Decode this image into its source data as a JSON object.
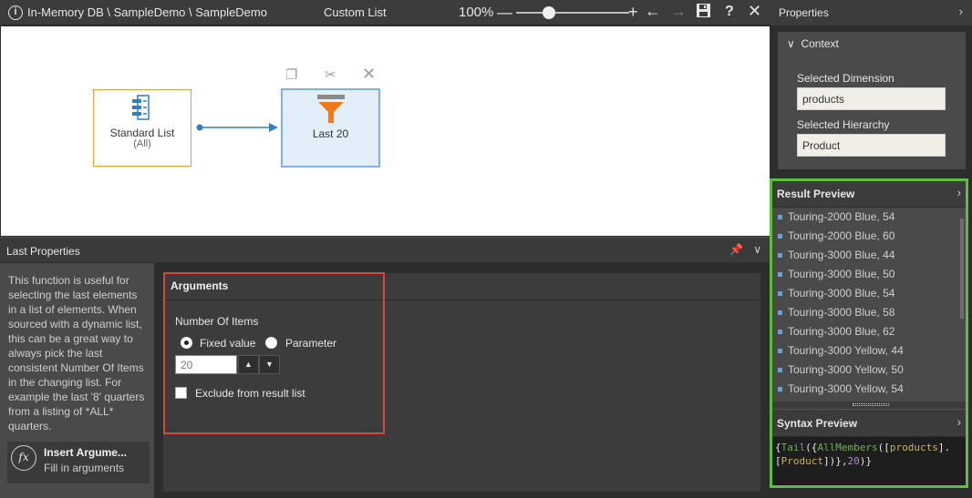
{
  "topbar": {
    "path": "In-Memory DB \\ SampleDemo \\ SampleDemo",
    "title": "Custom List",
    "zoom": "100%"
  },
  "canvas": {
    "node_standard": {
      "label": "Standard List",
      "sub": "(All)"
    },
    "node_last": {
      "label": "Last 20"
    }
  },
  "props": {
    "title": "Last Properties",
    "help": "This function is useful for selecting the last elements in a list of elements. When sourced with a dynamic list, this can be a great way to always pick the last consistent Number Of Items in the changing list. For example the last '8' quarters from a listing of *ALL* quarters.",
    "insert_title": "Insert Argume...",
    "insert_sub": "Fill in arguments",
    "args_title": "Arguments",
    "noi_label": "Number Of Items",
    "radio_fixed": "Fixed value",
    "radio_param": "Parameter",
    "noi_value": "20",
    "exclude_label": "Exclude from result list"
  },
  "right": {
    "title": "Properties",
    "context_title": "Context",
    "sel_dim_label": "Selected Dimension",
    "sel_dim_value": "products",
    "sel_hier_label": "Selected Hierarchy",
    "sel_hier_value": "Product",
    "result_title": "Result Preview",
    "result_items": [
      "Touring-2000 Blue, 54",
      "Touring-2000 Blue, 60",
      "Touring-3000 Blue, 44",
      "Touring-3000 Blue, 50",
      "Touring-3000 Blue, 54",
      "Touring-3000 Blue, 58",
      "Touring-3000 Blue, 62",
      "Touring-3000 Yellow, 44",
      "Touring-3000 Yellow, 50",
      "Touring-3000 Yellow, 54"
    ],
    "syntax_title": "Syntax Preview",
    "syntax": {
      "p1": "{",
      "fn1": "Tail",
      "p2": "({",
      "fn2": "AllMembers",
      "p3": "([",
      "dim": "products",
      "p4": "].",
      "p5": "[",
      "hier": "Product",
      "p6": "])},",
      "num": "20",
      "p7": ")}"
    }
  },
  "colors": {
    "highlight_red": "#d9463e",
    "highlight_green": "#5bbf3c",
    "node_orange": "#e89a3c",
    "node_blue": "#7eb1e8"
  }
}
